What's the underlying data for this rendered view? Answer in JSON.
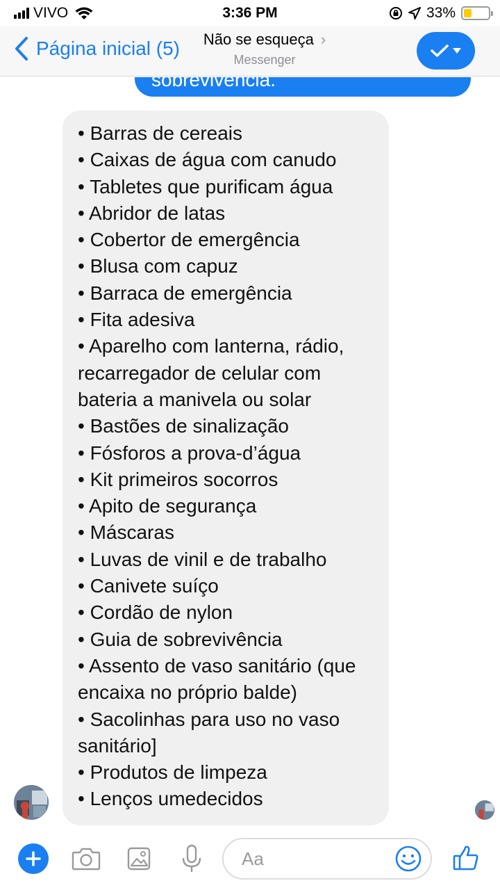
{
  "status_bar": {
    "carrier": "VIVO",
    "time": "3:36 PM",
    "battery": "33%",
    "battery_level": 0.33
  },
  "nav": {
    "back_label": "Página inicial (5)",
    "title": "Não se esqueça",
    "subtitle": "Messenger",
    "done_icon": "check-icon"
  },
  "previous_message": {
    "text": "sobrevivência."
  },
  "message": {
    "lines": [
      "• Barras de cereais",
      "• Caixas de água com canudo",
      "• Tabletes que purificam água",
      "• Abridor de latas",
      "• Cobertor de emergência",
      "• Blusa com capuz",
      "• Barraca de emergência",
      "• Fita adesiva",
      "• Aparelho com lanterna, rádio,",
      "recarregador de celular com",
      "bateria a manivela ou solar",
      "• Bastões de sinalização",
      "• Fósforos a prova-d’água",
      "• Kit primeiros socorros",
      "• Apito de segurança",
      "• Máscaras",
      "• Luvas de vinil e de trabalho",
      "• Canivete suíço",
      "• Cordão de nylon",
      "• Guia de sobrevivência",
      "• Assento de vaso sanitário (que",
      "encaixa no próprio balde)",
      "• Sacolinhas para uso no vaso",
      "sanitário]",
      "• Produtos de limpeza",
      "• Lenços umedecidos"
    ]
  },
  "composer": {
    "placeholder": "Aa",
    "icons": [
      "plus-icon",
      "camera-icon",
      "gallery-icon",
      "microphone-icon",
      "emoji-icon",
      "thumbs-up-icon"
    ]
  },
  "colors": {
    "accent": "#1a7ff0",
    "bubble_bg": "#f0f0f0",
    "battery": "#ffcc00"
  }
}
